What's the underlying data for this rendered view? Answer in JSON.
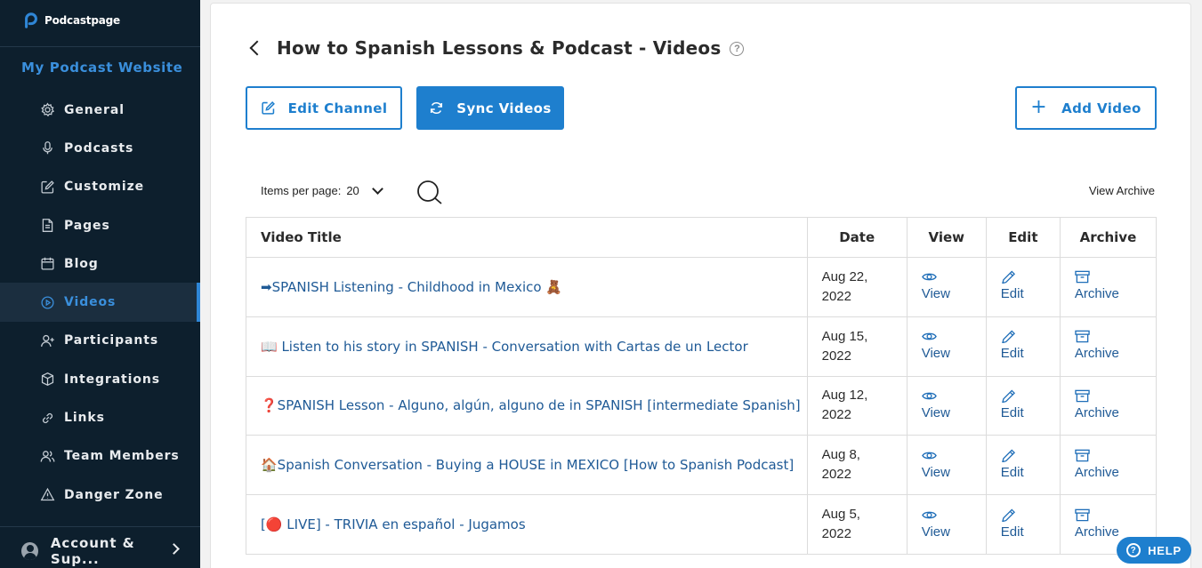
{
  "brand": {
    "name": "Podcastpage"
  },
  "sidebar": {
    "site_title": "My Podcast Website",
    "items": [
      {
        "label": "General",
        "icon": "gear-icon",
        "active": false
      },
      {
        "label": "Podcasts",
        "icon": "microphone-icon",
        "active": false
      },
      {
        "label": "Customize",
        "icon": "edit-square-icon",
        "active": false
      },
      {
        "label": "Pages",
        "icon": "document-icon",
        "active": false
      },
      {
        "label": "Blog",
        "icon": "calendar-icon",
        "active": false
      },
      {
        "label": "Videos",
        "icon": "play-circle-icon",
        "active": true
      },
      {
        "label": "Participants",
        "icon": "user-plus-icon",
        "active": false
      },
      {
        "label": "Integrations",
        "icon": "cube-icon",
        "active": false
      },
      {
        "label": "Links",
        "icon": "link-icon",
        "active": false
      },
      {
        "label": "Team Members",
        "icon": "users-icon",
        "active": false
      },
      {
        "label": "Danger Zone",
        "icon": "warning-icon",
        "active": false
      }
    ],
    "account_label": "Account & Sup..."
  },
  "main": {
    "title": "How to Spanish Lessons & Podcast - Videos",
    "help_glyph": "?",
    "buttons": {
      "edit_channel": "Edit Channel",
      "sync_videos": "Sync Videos",
      "add_video": "Add Video",
      "add_glyph": "+"
    },
    "items_per_page_label": "Items per page:",
    "items_per_page_value": "20",
    "view_archive": "View Archive",
    "table": {
      "headers": [
        "Video Title",
        "Date",
        "View",
        "Edit",
        "Archive"
      ],
      "rows": [
        {
          "title": "➡SPANISH Listening - Childhood in Mexico 🧸",
          "date_line1": "Aug 22,",
          "date_line2": "2022",
          "view": "View",
          "edit": "Edit",
          "archive": "Archive"
        },
        {
          "title": "📖 Listen to his story in SPANISH - Conversation with Cartas de un Lector",
          "date_line1": "Aug 15,",
          "date_line2": "2022",
          "view": "View",
          "edit": "Edit",
          "archive": "Archive"
        },
        {
          "title": "❓SPANISH Lesson - Alguno, algún, alguno de in SPANISH [intermediate Spanish]",
          "date_line1": "Aug 12,",
          "date_line2": "2022",
          "view": "View",
          "edit": "Edit",
          "archive": "Archive"
        },
        {
          "title": "🏠Spanish Conversation - Buying a HOUSE in MEXICO [How to Spanish Podcast]",
          "date_line1": "Aug 8,",
          "date_line2": "2022",
          "view": "View",
          "edit": "Edit",
          "archive": "Archive"
        },
        {
          "title": "[🔴 LIVE] - TRIVIA en español - Jugamos",
          "date_line1": "Aug 5,",
          "date_line2": "2022",
          "view": "View",
          "edit": "Edit",
          "archive": "Archive"
        }
      ]
    }
  },
  "help_button": {
    "label": "HELP",
    "glyph": "?"
  },
  "colors": {
    "sidebar_bg": "#0d1f2d",
    "accent": "#1e7fce",
    "link": "#1f5a96"
  }
}
